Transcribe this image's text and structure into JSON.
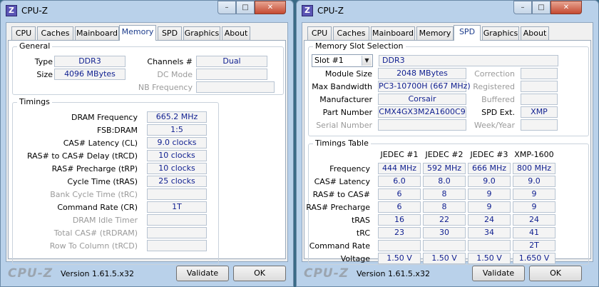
{
  "left_window": {
    "title": "CPU-Z",
    "icon_letter": "Z",
    "tabs": [
      "CPU",
      "Caches",
      "Mainboard",
      "Memory",
      "SPD",
      "Graphics",
      "About"
    ],
    "active_tab": "Memory",
    "general": {
      "title": "General",
      "type_label": "Type",
      "type_value": "DDR3",
      "size_label": "Size",
      "size_value": "4096 MBytes",
      "channels_label": "Channels #",
      "channels_value": "Dual",
      "dc_mode_label": "DC Mode",
      "nb_freq_label": "NB Frequency"
    },
    "timings": {
      "title": "Timings",
      "rows": [
        {
          "label": "DRAM Frequency",
          "value": "665.2 MHz",
          "enabled": true
        },
        {
          "label": "FSB:DRAM",
          "value": "1:5",
          "enabled": true
        },
        {
          "label": "CAS# Latency (CL)",
          "value": "9.0 clocks",
          "enabled": true
        },
        {
          "label": "RAS# to CAS# Delay (tRCD)",
          "value": "10 clocks",
          "enabled": true
        },
        {
          "label": "RAS# Precharge (tRP)",
          "value": "10 clocks",
          "enabled": true
        },
        {
          "label": "Cycle Time (tRAS)",
          "value": "25 clocks",
          "enabled": true
        },
        {
          "label": "Bank Cycle Time (tRC)",
          "value": "",
          "enabled": false
        },
        {
          "label": "Command Rate (CR)",
          "value": "1T",
          "enabled": true
        },
        {
          "label": "DRAM Idle Timer",
          "value": "",
          "enabled": false
        },
        {
          "label": "Total CAS# (tRDRAM)",
          "value": "",
          "enabled": false
        },
        {
          "label": "Row To Column (tRCD)",
          "value": "",
          "enabled": false
        }
      ]
    },
    "footer": {
      "brand": "CPU-Z",
      "version": "Version 1.61.5.x32",
      "validate": "Validate",
      "ok": "OK"
    }
  },
  "right_window": {
    "title": "CPU-Z",
    "icon_letter": "Z",
    "tabs": [
      "CPU",
      "Caches",
      "Mainboard",
      "Memory",
      "SPD",
      "Graphics",
      "About"
    ],
    "active_tab": "SPD",
    "slot": {
      "title": "Memory Slot Selection",
      "selected_slot": "Slot #1",
      "type_value": "DDR3",
      "module_size_label": "Module Size",
      "module_size_value": "2048 MBytes",
      "max_bw_label": "Max Bandwidth",
      "max_bw_value": "PC3-10700H (667 MHz)",
      "manufacturer_label": "Manufacturer",
      "manufacturer_value": "Corsair",
      "part_label": "Part Number",
      "part_value": "CMX4GX3M2A1600C9",
      "serial_label": "Serial Number",
      "correction_label": "Correction",
      "registered_label": "Registered",
      "buffered_label": "Buffered",
      "spd_ext_label": "SPD Ext.",
      "spd_ext_value": "XMP",
      "week_year_label": "Week/Year"
    },
    "timings_table": {
      "title": "Timings Table",
      "columns": [
        "JEDEC #1",
        "JEDEC #2",
        "JEDEC #3",
        "XMP-1600"
      ],
      "rows": [
        {
          "label": "Frequency",
          "values": [
            "444 MHz",
            "592 MHz",
            "666 MHz",
            "800 MHz"
          ]
        },
        {
          "label": "CAS# Latency",
          "values": [
            "6.0",
            "8.0",
            "9.0",
            "9.0"
          ]
        },
        {
          "label": "RAS# to CAS#",
          "values": [
            "6",
            "8",
            "9",
            "9"
          ]
        },
        {
          "label": "RAS# Precharge",
          "values": [
            "6",
            "8",
            "9",
            "9"
          ]
        },
        {
          "label": "tRAS",
          "values": [
            "16",
            "22",
            "24",
            "24"
          ]
        },
        {
          "label": "tRC",
          "values": [
            "23",
            "30",
            "34",
            "41"
          ]
        },
        {
          "label": "Command Rate",
          "values": [
            "",
            "",
            "",
            "2T"
          ]
        },
        {
          "label": "Voltage",
          "values": [
            "1.50 V",
            "1.50 V",
            "1.50 V",
            "1.650 V"
          ]
        }
      ]
    },
    "footer": {
      "brand": "CPU-Z",
      "version": "Version 1.61.5.x32",
      "validate": "Validate",
      "ok": "OK"
    }
  }
}
